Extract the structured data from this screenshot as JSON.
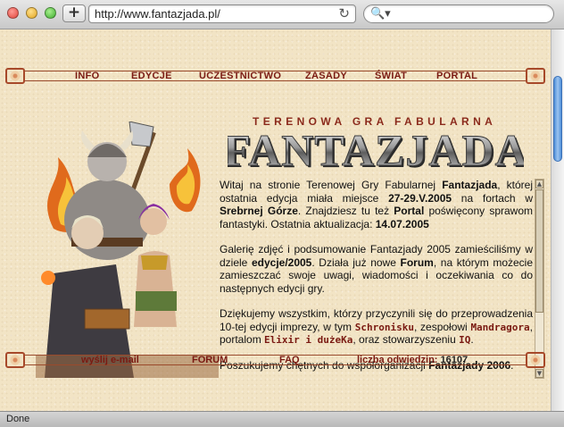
{
  "browser": {
    "url": "http://www.fantazjada.pl/",
    "new_tab_label": "+",
    "reload_glyph": "↻",
    "search_glyph": "🔍▾",
    "status": "Done"
  },
  "nav_top": [
    "INFO",
    "EDYCJE",
    "UCZESTNICTWO",
    "ZASADY",
    "ŚWIAT",
    "PORTAL"
  ],
  "header": {
    "subtitle": "TERENOWA GRA FABULARNA",
    "logo": "FANTAZJADA"
  },
  "content": {
    "p1": [
      {
        "t": "Witaj na stronie Terenowej Gry Fabularnej "
      },
      {
        "t": "Fantazjada",
        "b": true
      },
      {
        "t": ", której ostatnia edycja miała miejsce "
      },
      {
        "t": "27-29.V.2005",
        "b": true
      },
      {
        "t": " na fortach w "
      },
      {
        "t": "Srebrnej Górze",
        "b": true
      },
      {
        "t": ". Znajdziesz tu też "
      },
      {
        "t": "Portal",
        "b": true
      },
      {
        "t": " poświęcony sprawom fantastyki. Ostatnia aktualizacja: "
      },
      {
        "t": "14.07.2005",
        "b": true
      }
    ],
    "p2": [
      {
        "t": "Galerię zdjęć i podsumowanie Fantazjady 2005 zamieściliśmy w dziele "
      },
      {
        "t": "edycje/2005",
        "b": true
      },
      {
        "t": ". Działa już nowe "
      },
      {
        "t": "Forum",
        "b": true
      },
      {
        "t": ", na którym możecie zamieszczać swoje uwagi, wiadomości i oczekiwania co do następnych edycji gry."
      }
    ],
    "p3": [
      {
        "t": "Dziękujemy wszystkim, którzy przyczynili się do przeprowadzenia 10-tej edycji imprezy, w tym "
      },
      {
        "t": "Schronisku",
        "red": true
      },
      {
        "t": ", zespołowi "
      },
      {
        "t": "Mandragora",
        "red": true
      },
      {
        "t": ", portalom "
      },
      {
        "t": "Elixir i dużeKa",
        "red": true
      },
      {
        "t": ", oraz stowarzyszeniu "
      },
      {
        "t": "IQ",
        "red": true
      },
      {
        "t": "."
      }
    ],
    "p4": [
      {
        "t": "Poszukujemy chętnych do współorganizacji "
      },
      {
        "t": "Fantazjady 2006",
        "b": true
      },
      {
        "t": "."
      }
    ]
  },
  "nav_bottom": {
    "email": "wyślij e-mail",
    "forum": "FORUM",
    "faq": "FAQ",
    "counter_label": "liczba odwiedzin:",
    "counter_value": "16107"
  },
  "colors": {
    "link": "#7a1a12",
    "ornament": "#a7492a",
    "paper": "#f2e4c5"
  },
  "icons": [
    "new-tab-icon",
    "reload-icon",
    "search-icon",
    "scroll-up-icon",
    "scroll-down-icon"
  ]
}
